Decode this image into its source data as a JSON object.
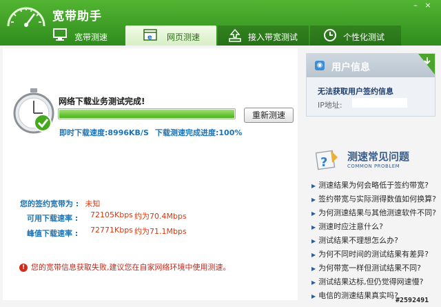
{
  "app": {
    "title": "宽带助手"
  },
  "tabs": [
    {
      "label": "宽带测速",
      "icon": "monitor-icon"
    },
    {
      "label": "网页测速",
      "icon": "browser-icon"
    },
    {
      "label": "接入带宽测试",
      "icon": "upload-icon"
    },
    {
      "label": "个性化测试",
      "icon": "clock-icon"
    }
  ],
  "test": {
    "status": "网络下载业务测试完成!",
    "progress_percent": 100,
    "retest_label": "重新测速",
    "instant_speed_label": "即时下载速度:",
    "instant_speed_value": "8996KB/S",
    "progress_label": "下载测速完成进度:",
    "progress_value": "100%"
  },
  "report": {
    "contract_label": "您的签约宽带为 :",
    "contract_value": "未知",
    "available_label": "可用下载速率 :",
    "available_kbps": "72105Kbps",
    "available_mbps": "约为70.4Mbps",
    "peak_label": "峰值下载速率 :",
    "peak_kbps": "72771Kbps",
    "peak_mbps": "约为71.1Mbps"
  },
  "error": {
    "message": "您的宽带信息获取失败,建议您在自家网络环境中使用测速。"
  },
  "user_card": {
    "title": "用户信息",
    "message": "无法获取用户签约信息",
    "ip_label": "IP地址:",
    "ip_value": ""
  },
  "faq": {
    "title": "测速常见问题",
    "subtitle": "COMMON PROBLEM",
    "items": [
      "测速结果为何会略低于签约带宽?",
      "签约带宽与实际测得数值如何换算?",
      "为何测速结果与其他测速软件不同?",
      "测速时应注意什么?",
      "测试结果不理想怎么办?",
      "为何不同时间的测试结果有差异?",
      "为何带宽一样但测试结果不同?",
      "测试结果达标,但仍觉得网速慢?",
      "电信的测速结果真实吗?"
    ]
  },
  "watermark": "#2592491",
  "colors": {
    "header_green": "#3a9e24",
    "accent_blue": "#1a73b8",
    "error_red": "#c82618"
  }
}
